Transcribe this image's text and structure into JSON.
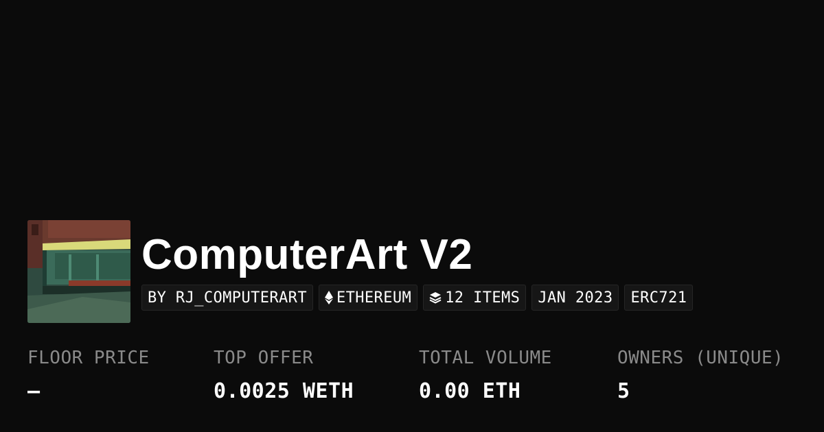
{
  "collection": {
    "name": "ComputerArt V2",
    "thumbnail": "nighthawks-style-artwork",
    "tags": [
      {
        "label": "BY RJ_COMPUTERART",
        "icon": ""
      },
      {
        "label": "ETHEREUM",
        "icon": "ethereum-icon"
      },
      {
        "label": "12 ITEMS",
        "icon": "layers-icon"
      },
      {
        "label": "JAN 2023",
        "icon": ""
      },
      {
        "label": "ERC721",
        "icon": ""
      }
    ]
  },
  "stats": [
    {
      "label": "FLOOR PRICE",
      "value": "–"
    },
    {
      "label": "TOP OFFER",
      "value": "0.0025 WETH"
    },
    {
      "label": "TOTAL VOLUME",
      "value": "0.00 ETH"
    },
    {
      "label": "OWNERS (UNIQUE)",
      "value": "5"
    }
  ],
  "colors": {
    "background": "#0b0b0b",
    "tag_background": "#161616",
    "stat_label": "#8a8a8a",
    "text": "#ffffff"
  }
}
